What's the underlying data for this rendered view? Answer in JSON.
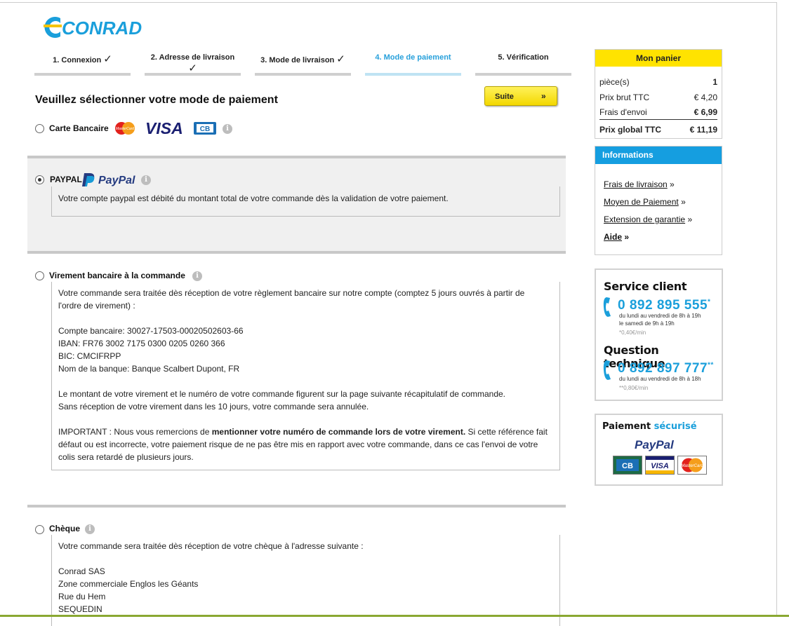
{
  "logo": {
    "text": "CONRAD"
  },
  "steps": [
    {
      "label": "1. Connexion",
      "done": true
    },
    {
      "label": "2. Adresse de livraison",
      "done": true
    },
    {
      "label": "3. Mode de livraison",
      "done": true
    },
    {
      "label": "4. Mode de paiement",
      "active": true
    },
    {
      "label": "5. Vérification"
    }
  ],
  "check_glyph": "✓",
  "page_title": "Veuillez sélectionner votre mode de paiement",
  "suite_button": {
    "label": "Suite",
    "arrow": "»"
  },
  "info_glyph": "i",
  "payment": {
    "carte": {
      "label": "Carte Bancaire",
      "selected": false
    },
    "paypal": {
      "label": "PAYPAL",
      "selected": true,
      "description": "Votre compte paypal est débité du montant total de votre commande dès la validation de votre paiement."
    },
    "virement": {
      "label": "Virement bancaire à la commande",
      "selected": false,
      "lines": [
        "Votre commande sera traitée dès réception de votre règlement bancaire sur notre compte (comptez 5 jours ouvrés à partir de",
        "l'ordre de virement) :",
        "",
        "Compte bancaire: 30027-17503-00020502603-66",
        "IBAN: FR76 3002 7175 0300 0205 0260 366",
        "BIC: CMCIFRPP",
        "Nom de la banque: Banque Scalbert Dupont, FR",
        "",
        "Le montant de votre virement et le numéro de votre commande figurent sur la page suivante récapitulatif de commande.",
        "Sans réception de votre virement dans les 10 jours, votre commande sera annulée.",
        ""
      ],
      "important_prefix": "IMPORTANT : Nous vous remercions de ",
      "important_bold": "mentionner votre numéro de commande lors de votre virement.",
      "important_suffix": " Si cette référence fait",
      "important_lines": [
        "défaut ou est incorrecte, votre paiement risque de ne pas être mis en rapport avec votre commande, dans ce cas l'envoi de votre",
        "colis sera retardé de plusieurs jours."
      ]
    },
    "cheque": {
      "label": "Chèque",
      "selected": false,
      "lines": [
        "Votre commande sera traitée dès réception de votre chèque à l'adresse suivante :",
        "",
        "Conrad SAS",
        "Zone commerciale Englos les Géants",
        "Rue du Hem",
        "SEQUEDIN"
      ]
    }
  },
  "card_logos": {
    "mastercard": "MasterCard",
    "visa": "VISA",
    "cb": "CB",
    "paypal": "PayPal"
  },
  "panier": {
    "title": "Mon panier",
    "rows": [
      {
        "label": "pièce(s)",
        "value": "1"
      },
      {
        "label": "Prix brut TTC",
        "value": "€ 4,20"
      },
      {
        "label": "Frais d'envoi",
        "value": "€ 6,99"
      },
      {
        "label": "Prix global TTC",
        "value": "€ 11,19"
      }
    ]
  },
  "informations": {
    "title": "Informations",
    "links": [
      {
        "label": "Frais de livraison",
        "arrow": "»"
      },
      {
        "label": "Moyen de Paiement",
        "arrow": "»"
      },
      {
        "label": "Extension de garantie",
        "arrow": "»"
      },
      {
        "label": "Aide",
        "arrow": "»"
      }
    ]
  },
  "service": {
    "title1": "Service client",
    "phone1": "0 892 895 555",
    "star1": "*",
    "hours1a": "du lundi au vendredi de 8h à 19h",
    "hours1b": "le samedi de 9h à 19h",
    "price1": "*0,40€/min",
    "title2": "Question technique",
    "phone2": "0 892 897 777",
    "star2": "**",
    "hours2": "du lundi au vendredi de 8h à 18h",
    "price2": "**0,80€/min"
  },
  "secure": {
    "title_a": "Paiement",
    "title_b": "sécurisé",
    "paypal": "PayPal"
  },
  "colors": {
    "accent_blue": "#1a9fdb",
    "yellow": "#ffe300",
    "paypal_dark": "#253b80",
    "paypal_light": "#179bd7"
  }
}
